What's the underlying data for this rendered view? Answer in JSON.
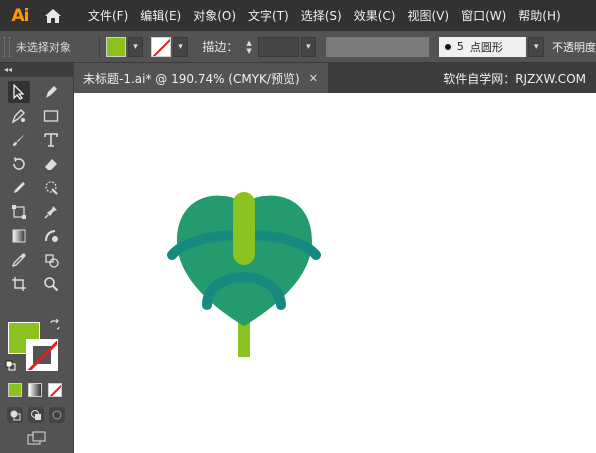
{
  "app": {
    "logo": "Ai"
  },
  "menu": [
    "文件(F)",
    "编辑(E)",
    "对象(O)",
    "文字(T)",
    "选择(S)",
    "效果(C)",
    "视图(V)",
    "窗口(W)",
    "帮助(H)"
  ],
  "control": {
    "selection_status": "未选择对象",
    "stroke_label": "描边：",
    "brush_size": "5",
    "brush_shape": "点圆形",
    "opacity_label": "不透明度"
  },
  "colors": {
    "fill": "#8cc21f",
    "leaf_green": "#239b6e",
    "vein_teal": "#168a7f",
    "stem_green": "#8cc21f",
    "accent": "#ff9a00"
  },
  "document": {
    "tab_title": "未标题-1.ai* @ 190.74% (CMYK/预览)",
    "watermark": "软件自学网：RJZXW.COM"
  },
  "toolpanel": {
    "collapse_label": "◂◂",
    "tools": [
      "selection-tool",
      "direct-selection-tool",
      "pen-tool",
      "rectangle-tool",
      "paintbrush-tool",
      "type-tool",
      "rotate-tool",
      "eraser-tool",
      "pencil-tool",
      "warp-tool",
      "free-transform-tool",
      "puppet-warp-tool",
      "gradient-tool",
      "shape-builder-tool",
      "eyedropper-tool",
      "symbol-sprayer-tool",
      "artboard-tool",
      "zoom-tool"
    ]
  }
}
